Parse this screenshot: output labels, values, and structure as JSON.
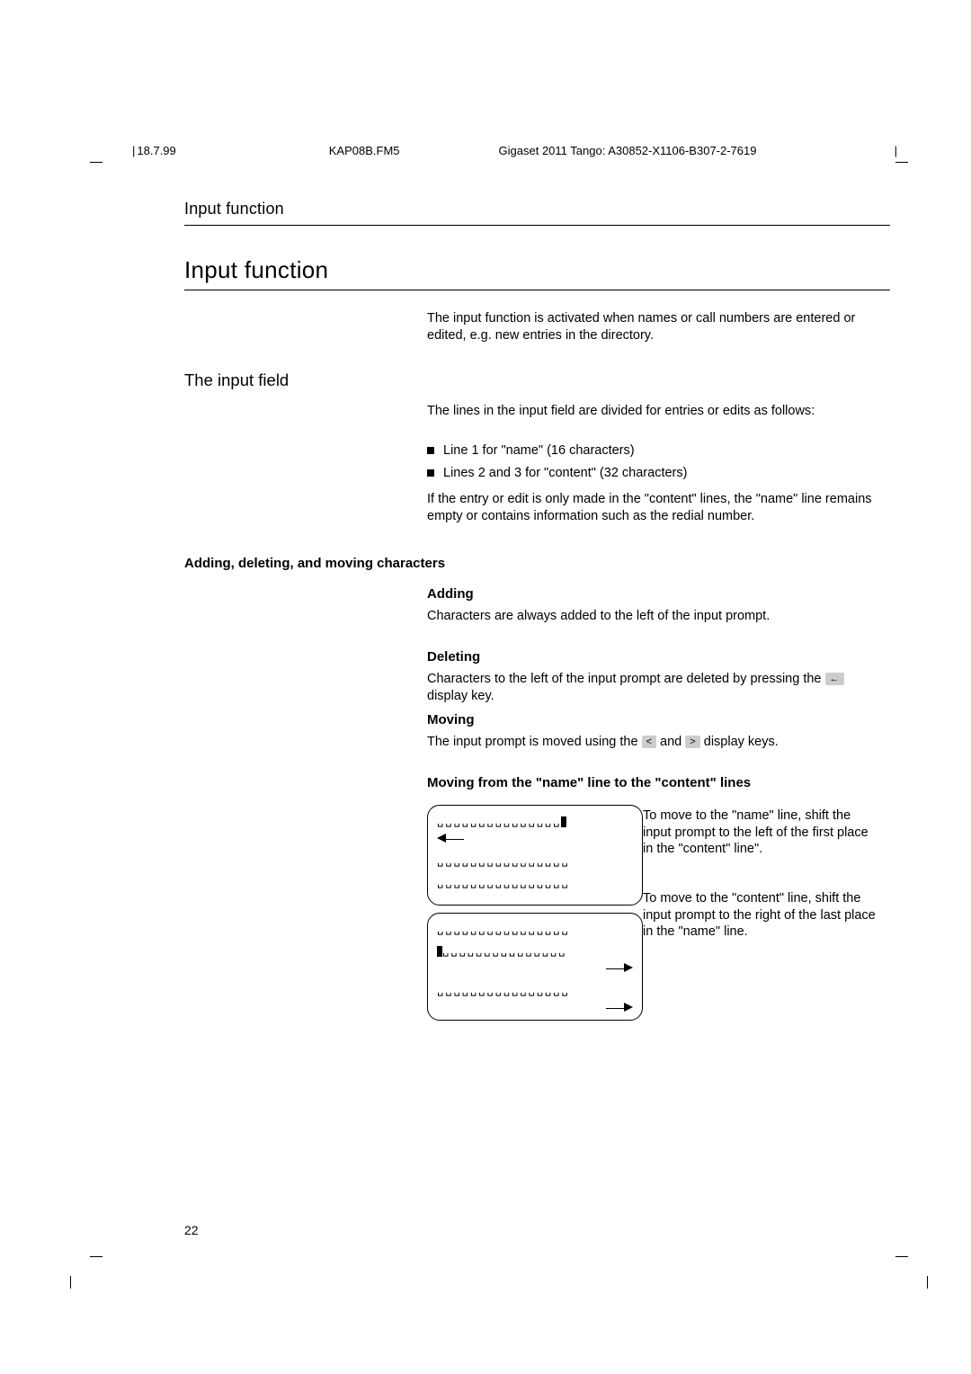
{
  "meta": {
    "date": "18.7.99",
    "file": "KAP08B.FM5",
    "doc": "Gigaset 2011 Tango: A30852-X1106-B307-2-7619"
  },
  "running_head": "Input function",
  "section_title": "Input function",
  "intro": "The input function is activated when names or call numbers are entered or edited, e.g. new entries in the directory.",
  "sub_input_field": "The input field",
  "body1": "The lines in the input field are divided for entries or edits as follows:",
  "bullets": {
    "b1": "Line 1 for \"name\" (16 characters)",
    "b2": "Lines 2 and 3 for \"content\" (32 characters)"
  },
  "body2": "If the entry or edit is only made in the \"content\" lines, the \"name\" line remains empty or contains information such as the redial number.",
  "sub_adm": "Adding, deleting, and moving characters",
  "h3": {
    "adding": "Adding",
    "deleting": "Deleting",
    "moving": "Moving",
    "moving_long": "Moving from the \"name\" line to the \"content\" lines"
  },
  "body3": "Characters are always added to the left of the input prompt.",
  "body4_a": "Characters to the left of the input prompt are deleted by pressing the ",
  "body4_b": " display key.",
  "body5_a": "The input prompt is moved using the ",
  "body5_b": " and ",
  "body5_c": " display keys.",
  "keys": {
    "back": "←",
    "lt": "<",
    "gt": ">"
  },
  "side1": "To move to the \"name\" line, shift the input prompt to the left of the first place in the \"content\" line\".",
  "side2": "To move to the \"content\" line, shift the input prompt to the right of the last place in the \"name\" line.",
  "page_number": "22"
}
